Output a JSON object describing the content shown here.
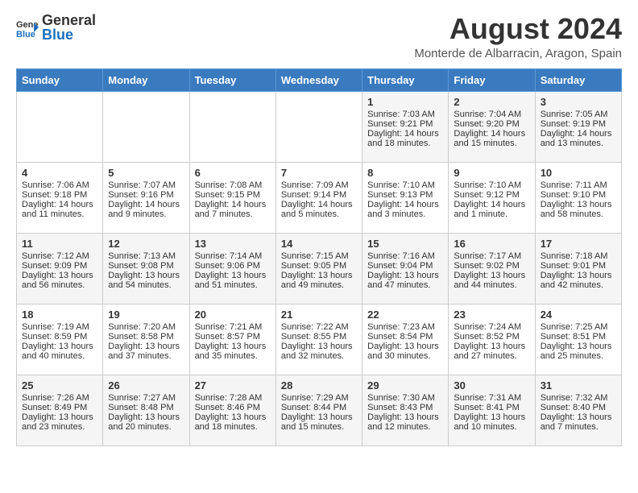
{
  "logo": {
    "text_general": "General",
    "text_blue": "Blue"
  },
  "title": {
    "month_year": "August 2024",
    "location": "Monterde de Albarracin, Aragon, Spain"
  },
  "days_of_week": [
    "Sunday",
    "Monday",
    "Tuesday",
    "Wednesday",
    "Thursday",
    "Friday",
    "Saturday"
  ],
  "weeks": [
    [
      {
        "day": "",
        "content": ""
      },
      {
        "day": "",
        "content": ""
      },
      {
        "day": "",
        "content": ""
      },
      {
        "day": "",
        "content": ""
      },
      {
        "day": "1",
        "content": "Sunrise: 7:03 AM\nSunset: 9:21 PM\nDaylight: 14 hours\nand 18 minutes."
      },
      {
        "day": "2",
        "content": "Sunrise: 7:04 AM\nSunset: 9:20 PM\nDaylight: 14 hours\nand 15 minutes."
      },
      {
        "day": "3",
        "content": "Sunrise: 7:05 AM\nSunset: 9:19 PM\nDaylight: 14 hours\nand 13 minutes."
      }
    ],
    [
      {
        "day": "4",
        "content": "Sunrise: 7:06 AM\nSunset: 9:18 PM\nDaylight: 14 hours\nand 11 minutes."
      },
      {
        "day": "5",
        "content": "Sunrise: 7:07 AM\nSunset: 9:16 PM\nDaylight: 14 hours\nand 9 minutes."
      },
      {
        "day": "6",
        "content": "Sunrise: 7:08 AM\nSunset: 9:15 PM\nDaylight: 14 hours\nand 7 minutes."
      },
      {
        "day": "7",
        "content": "Sunrise: 7:09 AM\nSunset: 9:14 PM\nDaylight: 14 hours\nand 5 minutes."
      },
      {
        "day": "8",
        "content": "Sunrise: 7:10 AM\nSunset: 9:13 PM\nDaylight: 14 hours\nand 3 minutes."
      },
      {
        "day": "9",
        "content": "Sunrise: 7:10 AM\nSunset: 9:12 PM\nDaylight: 14 hours\nand 1 minute."
      },
      {
        "day": "10",
        "content": "Sunrise: 7:11 AM\nSunset: 9:10 PM\nDaylight: 13 hours\nand 58 minutes."
      }
    ],
    [
      {
        "day": "11",
        "content": "Sunrise: 7:12 AM\nSunset: 9:09 PM\nDaylight: 13 hours\nand 56 minutes."
      },
      {
        "day": "12",
        "content": "Sunrise: 7:13 AM\nSunset: 9:08 PM\nDaylight: 13 hours\nand 54 minutes."
      },
      {
        "day": "13",
        "content": "Sunrise: 7:14 AM\nSunset: 9:06 PM\nDaylight: 13 hours\nand 51 minutes."
      },
      {
        "day": "14",
        "content": "Sunrise: 7:15 AM\nSunset: 9:05 PM\nDaylight: 13 hours\nand 49 minutes."
      },
      {
        "day": "15",
        "content": "Sunrise: 7:16 AM\nSunset: 9:04 PM\nDaylight: 13 hours\nand 47 minutes."
      },
      {
        "day": "16",
        "content": "Sunrise: 7:17 AM\nSunset: 9:02 PM\nDaylight: 13 hours\nand 44 minutes."
      },
      {
        "day": "17",
        "content": "Sunrise: 7:18 AM\nSunset: 9:01 PM\nDaylight: 13 hours\nand 42 minutes."
      }
    ],
    [
      {
        "day": "18",
        "content": "Sunrise: 7:19 AM\nSunset: 8:59 PM\nDaylight: 13 hours\nand 40 minutes."
      },
      {
        "day": "19",
        "content": "Sunrise: 7:20 AM\nSunset: 8:58 PM\nDaylight: 13 hours\nand 37 minutes."
      },
      {
        "day": "20",
        "content": "Sunrise: 7:21 AM\nSunset: 8:57 PM\nDaylight: 13 hours\nand 35 minutes."
      },
      {
        "day": "21",
        "content": "Sunrise: 7:22 AM\nSunset: 8:55 PM\nDaylight: 13 hours\nand 32 minutes."
      },
      {
        "day": "22",
        "content": "Sunrise: 7:23 AM\nSunset: 8:54 PM\nDaylight: 13 hours\nand 30 minutes."
      },
      {
        "day": "23",
        "content": "Sunrise: 7:24 AM\nSunset: 8:52 PM\nDaylight: 13 hours\nand 27 minutes."
      },
      {
        "day": "24",
        "content": "Sunrise: 7:25 AM\nSunset: 8:51 PM\nDaylight: 13 hours\nand 25 minutes."
      }
    ],
    [
      {
        "day": "25",
        "content": "Sunrise: 7:26 AM\nSunset: 8:49 PM\nDaylight: 13 hours\nand 23 minutes."
      },
      {
        "day": "26",
        "content": "Sunrise: 7:27 AM\nSunset: 8:48 PM\nDaylight: 13 hours\nand 20 minutes."
      },
      {
        "day": "27",
        "content": "Sunrise: 7:28 AM\nSunset: 8:46 PM\nDaylight: 13 hours\nand 18 minutes."
      },
      {
        "day": "28",
        "content": "Sunrise: 7:29 AM\nSunset: 8:44 PM\nDaylight: 13 hours\nand 15 minutes."
      },
      {
        "day": "29",
        "content": "Sunrise: 7:30 AM\nSunset: 8:43 PM\nDaylight: 13 hours\nand 12 minutes."
      },
      {
        "day": "30",
        "content": "Sunrise: 7:31 AM\nSunset: 8:41 PM\nDaylight: 13 hours\nand 10 minutes."
      },
      {
        "day": "31",
        "content": "Sunrise: 7:32 AM\nSunset: 8:40 PM\nDaylight: 13 hours\nand 7 minutes."
      }
    ]
  ]
}
